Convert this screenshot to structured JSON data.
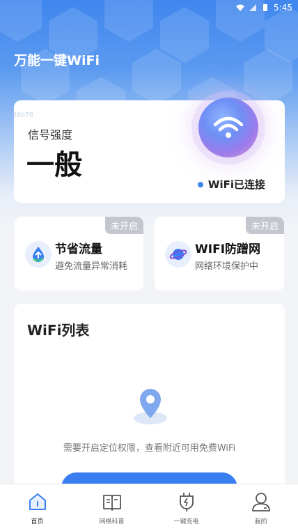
{
  "status_bar": {
    "time": "5:45"
  },
  "app": {
    "title": "万能一键WiFi",
    "debug_tag": "30b78"
  },
  "signal": {
    "label": "信号强度",
    "value": "一般",
    "connection_status": "WiFi已连接"
  },
  "features": [
    {
      "title": "节省流量",
      "subtitle": "避免流量异常消耗",
      "badge": "未开启",
      "icon": "droplet-icon"
    },
    {
      "title": "WIFI防蹭网",
      "subtitle": "网络环境保护中",
      "badge": "未开启",
      "icon": "planet-icon"
    }
  ],
  "wifi_list": {
    "title": "WiFi列表",
    "empty_message": "需要开启定位权限，查看附近可用免费WiFi",
    "icon": "location-pin-icon"
  },
  "bottom_nav": [
    {
      "label": "首页",
      "icon": "home-icon",
      "active": true
    },
    {
      "label": "网络科普",
      "icon": "book-icon",
      "active": false
    },
    {
      "label": "一键充电",
      "icon": "charge-icon",
      "active": false
    },
    {
      "label": "我的",
      "icon": "user-icon",
      "active": false
    }
  ],
  "colors": {
    "accent": "#3a7ef2",
    "badge": "#c3c6cc"
  }
}
